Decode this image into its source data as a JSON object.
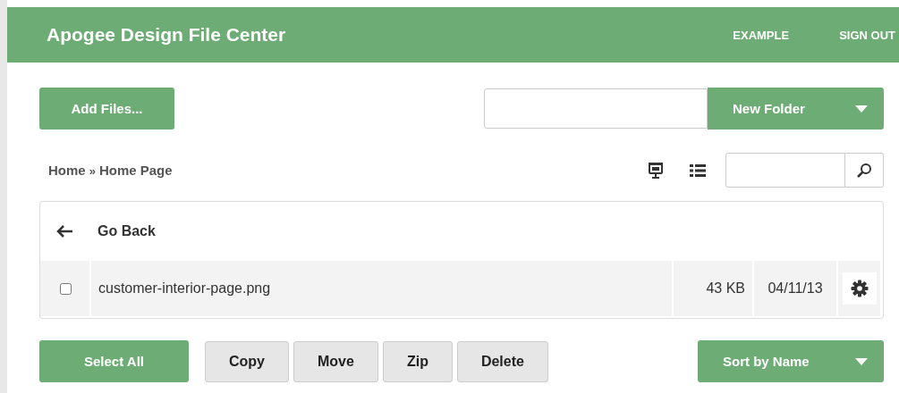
{
  "header": {
    "title": "Apogee Design File Center",
    "links": [
      "EXAMPLE",
      "SIGN OUT"
    ]
  },
  "toolbar": {
    "add_button": "Add Files...",
    "new_folder": "New Folder"
  },
  "breadcrumb": {
    "parts": [
      "Home",
      "»",
      "Home Page"
    ]
  },
  "view_modes": [
    {
      "kind": "presentation"
    },
    {
      "kind": "list"
    }
  ],
  "file_list": {
    "back": "Go Back",
    "rows": [
      {
        "name": "customer-interior-page.png",
        "size": "43 KB",
        "date": "04/11/13",
        "checked": false
      }
    ]
  },
  "actions": {
    "select_all": "Select All",
    "buttons": [
      "Copy",
      "Move",
      "Zip",
      "Delete"
    ],
    "sort": "Sort by Name"
  }
}
